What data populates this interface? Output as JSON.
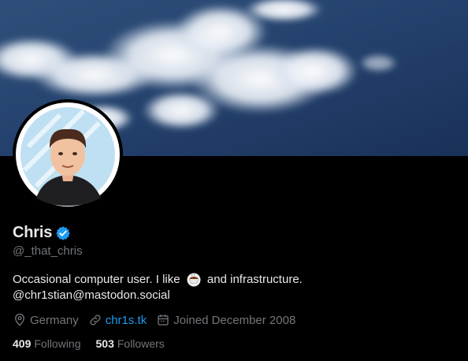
{
  "profile": {
    "name": "Chris",
    "handle": "@_that_chris",
    "verified": true,
    "bio_line1_before": "Occasional computer user. I like ",
    "bio_emoji_icon": "coffee-cup-icon",
    "bio_line1_after": " and infrastructure.",
    "bio_line2": "@chr1stian@mastodon.social",
    "location": "Germany",
    "website": "chr1s.tk",
    "joined": "Joined December 2008",
    "following_count": "409",
    "following_label": "Following",
    "followers_count": "503",
    "followers_label": "Followers"
  },
  "icons": {
    "location": "location-pin-icon",
    "website": "link-icon",
    "joined": "calendar-icon",
    "verified": "verified-badge-icon"
  },
  "colors": {
    "background": "#000000",
    "text_primary": "#e7e9ea",
    "text_secondary": "#71767b",
    "accent": "#1d9bf0"
  }
}
